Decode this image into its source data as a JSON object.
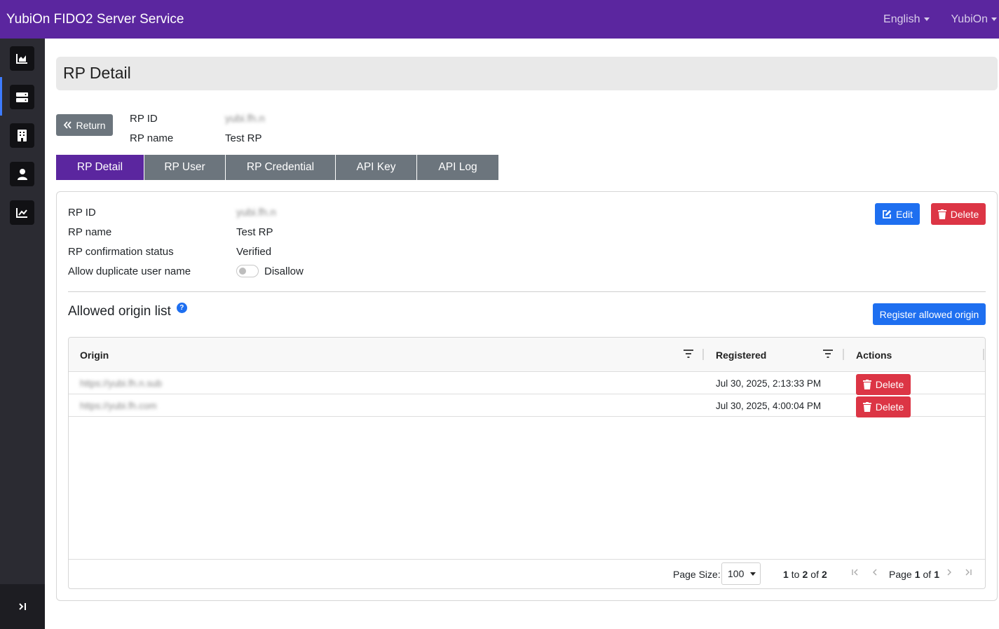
{
  "app": {
    "title": "YubiOn FIDO2 Server Service"
  },
  "topnav": {
    "language": "English",
    "user": "YubiOn"
  },
  "sidebar": {
    "items": [
      {
        "icon": "chart-area-icon"
      },
      {
        "icon": "server-icon"
      },
      {
        "icon": "building-icon"
      },
      {
        "icon": "user-icon"
      },
      {
        "icon": "chart-line-icon"
      }
    ],
    "active_index": 1,
    "collapse_icon": "collapse-toggle-icon"
  },
  "page": {
    "title": "RP Detail"
  },
  "header_info": {
    "return_label": "Return",
    "rp_id_label": "RP ID",
    "rp_id_value": "yubi.fh.n",
    "rp_name_label": "RP name",
    "rp_name_value": "Test RP"
  },
  "tabs": [
    {
      "label": "RP Detail",
      "active": true
    },
    {
      "label": "RP User",
      "active": false
    },
    {
      "label": "RP Credential",
      "active": false
    },
    {
      "label": "API Key",
      "active": false
    },
    {
      "label": "API Log",
      "active": false
    }
  ],
  "details": {
    "rp_id_label": "RP ID",
    "rp_id_value": "yubi.fh.n",
    "rp_name_label": "RP name",
    "rp_name_value": "Test RP",
    "confirm_label": "RP confirmation status",
    "confirm_value": "Verified",
    "duplicate_label": "Allow duplicate user name",
    "duplicate_value": "Disallow",
    "edit_label": "Edit",
    "delete_label": "Delete"
  },
  "origins": {
    "title": "Allowed origin list",
    "help_glyph": "?",
    "register_label": "Register allowed origin",
    "columns": {
      "origin": "Origin",
      "registered": "Registered",
      "actions": "Actions"
    },
    "rows": [
      {
        "origin": "https://yubi.fh.n.sub",
        "registered": "Jul 30, 2025, 2:13:33 PM",
        "action": "Delete"
      },
      {
        "origin": "https://yubi.fh.com",
        "registered": "Jul 30, 2025, 4:00:04 PM",
        "action": "Delete"
      }
    ],
    "footer": {
      "page_size_label": "Page Size:",
      "page_size_value": "100",
      "range_from": "1",
      "range_to_word": "to",
      "range_to": "2",
      "range_of_word": "of",
      "range_total": "2",
      "page_word": "Page",
      "page_current": "1",
      "page_of_word": "of",
      "page_total": "1"
    }
  },
  "colors": {
    "brand": "#5b269f",
    "primary": "#1e6ff0",
    "danger": "#dc3545",
    "secondary": "#6c757d"
  }
}
